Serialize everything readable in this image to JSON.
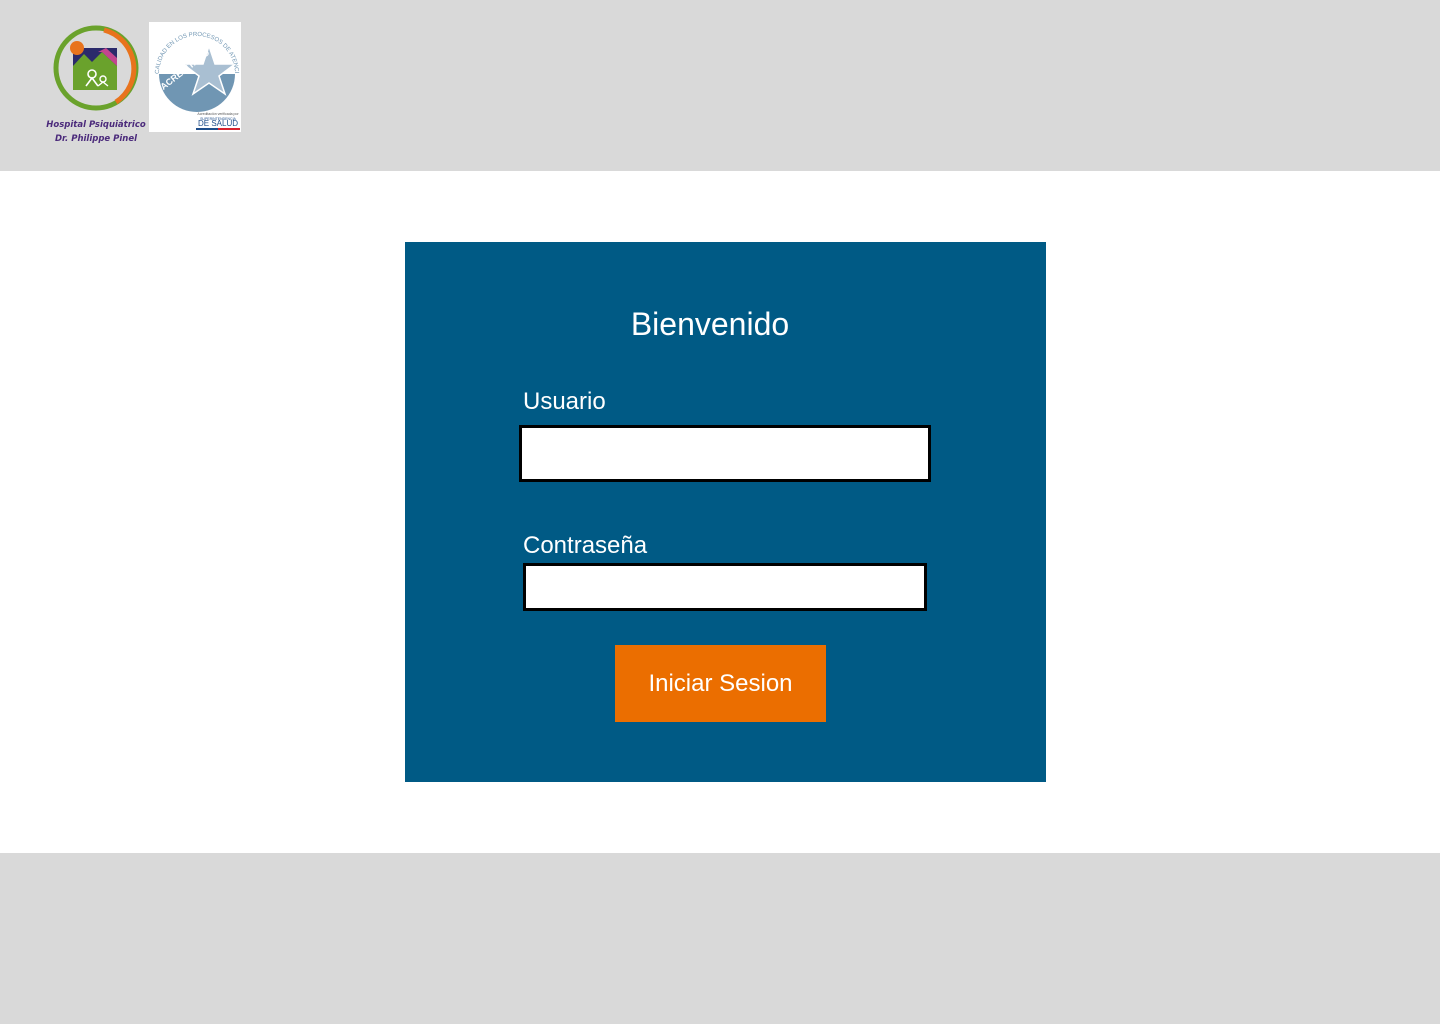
{
  "header": {
    "hospital_name_line1": "Hospital Psiquiátrico",
    "hospital_name_line2": "Dr. Philippe Pinel",
    "seal": {
      "arc_text": "CALIDAD EN LOS PROCESOS DE ATENCIÓN EN SALUD",
      "status": "ACREDITADO",
      "small_text": "Acreditación verificada por",
      "authority_line1": "SUPERINTENDENCIA",
      "authority_line2": "DE SALUD"
    }
  },
  "login": {
    "title": "Bienvenido",
    "username_label": "Usuario",
    "username_value": "",
    "password_label": "Contraseña",
    "password_value": "",
    "submit_label": "Iniciar Sesion"
  },
  "colors": {
    "header_bg": "#d9d9d9",
    "card_bg": "#005a85",
    "button_bg": "#eb6e00",
    "logo_green": "#6aa22c",
    "logo_orange": "#e8731d",
    "logo_navy": "#2b2a6b",
    "seal_blue": "#7096b3"
  }
}
